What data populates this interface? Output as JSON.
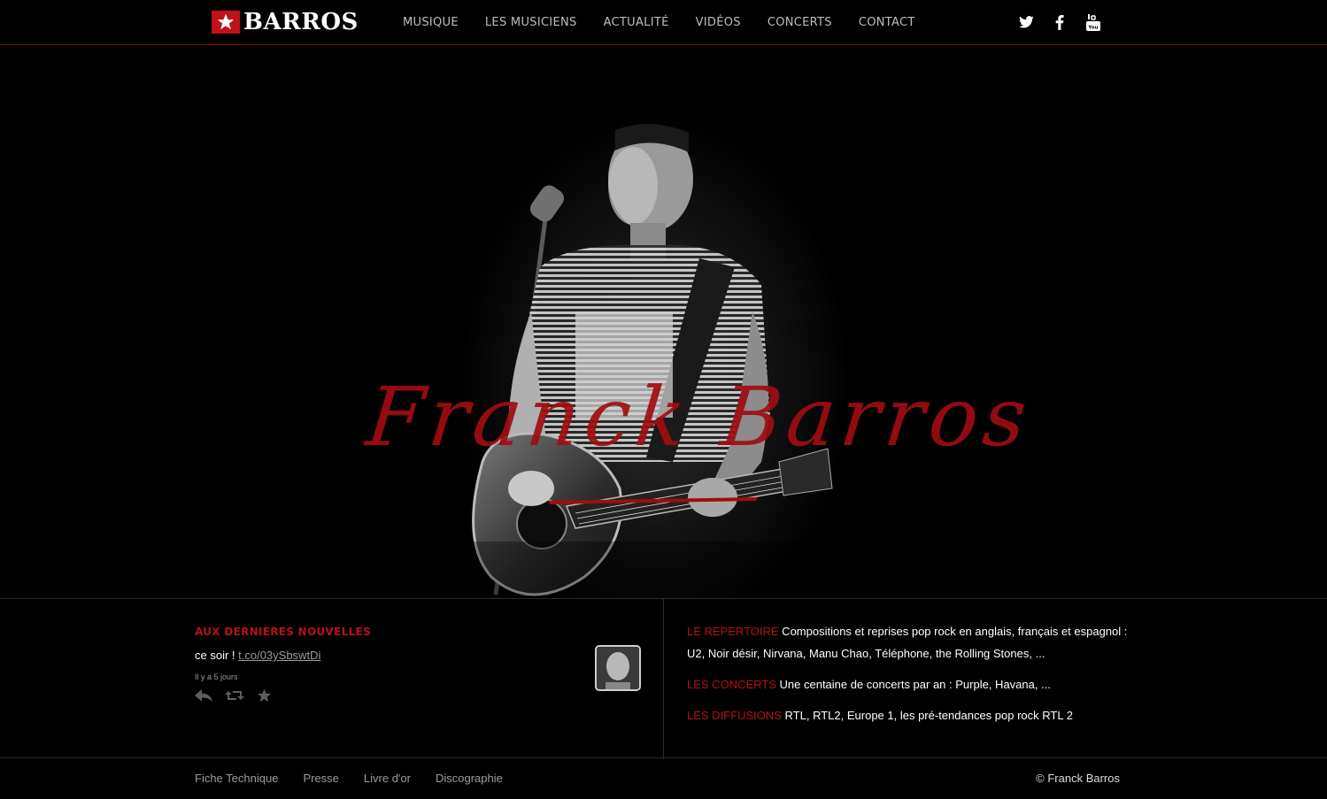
{
  "header": {
    "logo_text": "BARROS",
    "nav": [
      {
        "label": "MUSIQUE"
      },
      {
        "label": "LES MUSICIENS"
      },
      {
        "label": "ACTUALITÉ"
      },
      {
        "label": "VIDÉOS"
      },
      {
        "label": "CONCERTS"
      },
      {
        "label": "CONTACT"
      }
    ],
    "social": [
      {
        "icon": "twitter-icon"
      },
      {
        "icon": "facebook-icon"
      },
      {
        "icon": "youtube-icon"
      }
    ]
  },
  "hero": {
    "title": "Franck Barros",
    "image": "photo of guitarist singing at microphone (black and white)"
  },
  "tweet": {
    "title": "AUX DERNIÈRES NOUVELLES",
    "text_prefix": "ce soir ! ",
    "link": "t.co/03ySbswtDi",
    "time": "Il y a 5 jours",
    "actions": [
      "reply-icon",
      "retweet-icon",
      "favorite-icon"
    ]
  },
  "facts": [
    {
      "key": "LE REPERTOIRE",
      "value": " Compositions et reprises pop rock en anglais, français et espagnol : U2, Noir désir, Nirvana, Manu Chao, Téléphone, the Rolling Stones, ..."
    },
    {
      "key": "LES CONCERTS",
      "value": " Une centaine de concerts par an : Purple, Havana, ..."
    },
    {
      "key": "LES DIFFUSIONS",
      "value": " RTL, RTL2, Europe 1, les pré-tendances pop rock RTL 2"
    }
  ],
  "footer": {
    "links": [
      {
        "label": "Fiche Technique"
      },
      {
        "label": "Presse"
      },
      {
        "label": "Livre d'or"
      },
      {
        "label": "Discographie"
      }
    ],
    "copyright": "© Franck Barros"
  },
  "colors": {
    "accent": "#b5121b",
    "background": "#000000"
  }
}
